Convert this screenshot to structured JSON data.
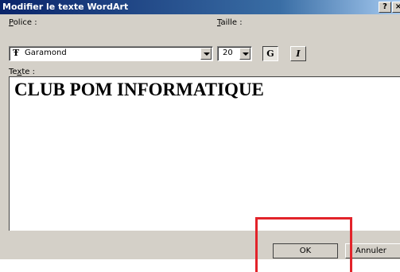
{
  "dialog": {
    "title": "Modifier le texte WordArt",
    "help_label": "?",
    "close_label": "×"
  },
  "font": {
    "label_pre": "",
    "label_key": "P",
    "label_post": "olice :",
    "value": "Garamond",
    "icon": "truetype-font-icon"
  },
  "size": {
    "label_pre": "",
    "label_key": "T",
    "label_post": "aille :",
    "value": "20"
  },
  "style": {
    "bold_label": "G",
    "italic_label": "I"
  },
  "text": {
    "label_pre": "Te",
    "label_key": "x",
    "label_post": "te :",
    "value": "CLUB POM INFORMATIQUE"
  },
  "buttons": {
    "ok_label": "OK",
    "cancel_label": "Annuler"
  },
  "colors": {
    "highlight": "#e2232a",
    "titlebar": "#0a246a"
  }
}
